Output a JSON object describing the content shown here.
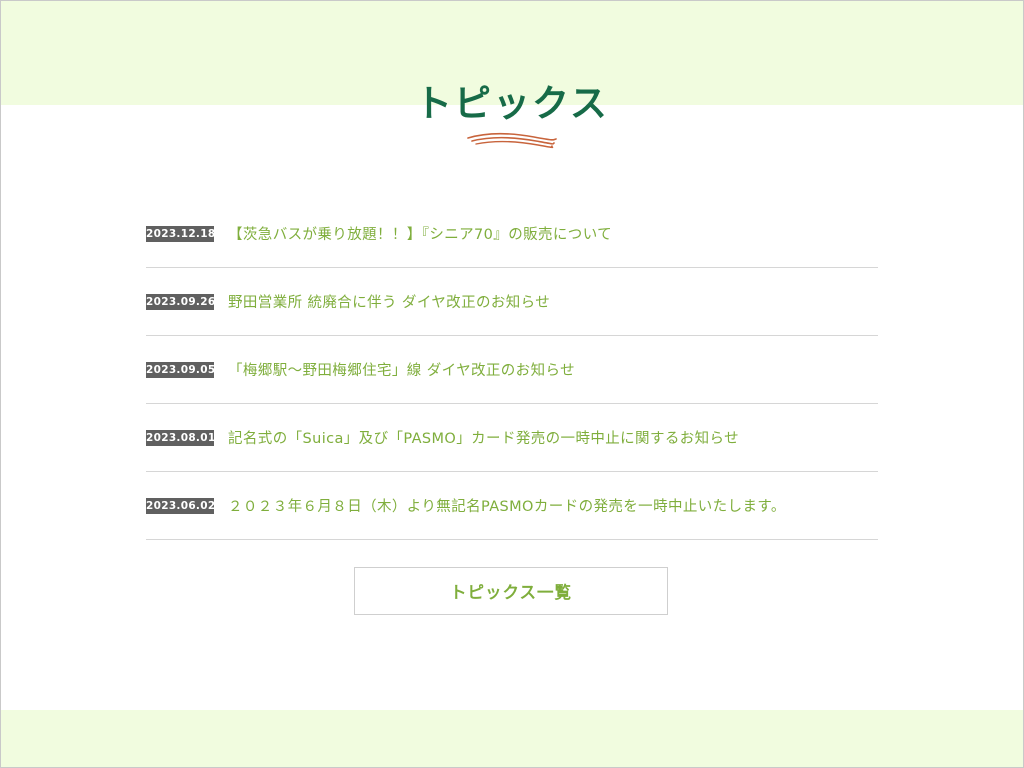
{
  "section": {
    "title": "トピックス"
  },
  "topics": [
    {
      "date": "2023.12.18",
      "title": "【茨急バスが乗り放題！！】『シニア70』の販売について"
    },
    {
      "date": "2023.09.26",
      "title": "野田営業所 統廃合に伴う ダイヤ改正のお知らせ"
    },
    {
      "date": "2023.09.05",
      "title": "「梅郷駅～野田梅郷住宅」線 ダイヤ改正のお知らせ"
    },
    {
      "date": "2023.08.01",
      "title": "記名式の「Suica」及び「PASMO」カード発売の一時中止に関するお知らせ"
    },
    {
      "date": "2023.06.02",
      "title": "２０２３年６月８日（木）より無記名PASMOカードの発売を一時中止いたします。"
    }
  ],
  "more_button": {
    "label": "トピックス一覧"
  },
  "colors": {
    "heading": "#176b48",
    "ornament": "#c8643c",
    "link_text": "#7fae3c",
    "date_badge_bg": "#606060",
    "band_bg": "#f1fcdf",
    "divider": "#d6d6d6"
  }
}
